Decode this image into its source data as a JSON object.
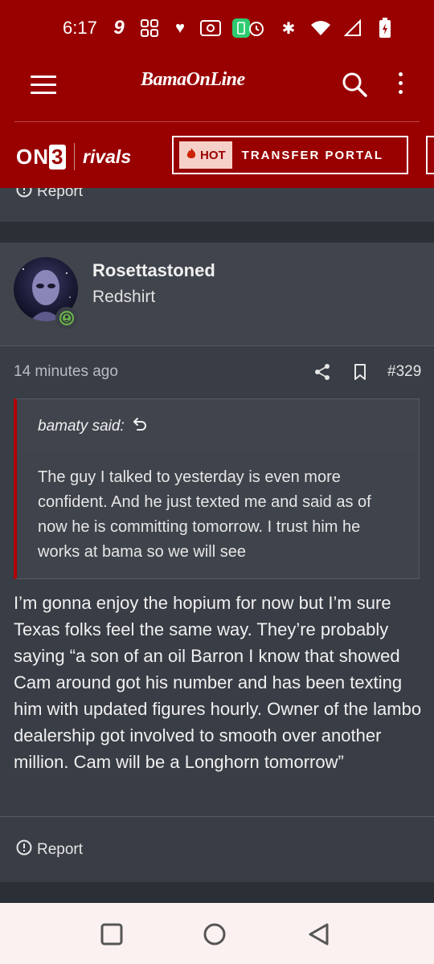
{
  "status_bar": {
    "time": "6:17",
    "left_icons": [
      "nine-app-icon",
      "grid-icon",
      "heart-icon",
      "broadcast-icon",
      "battery-app-icon"
    ],
    "right_icons": [
      "alarm-icon",
      "bluetooth-icon",
      "wifi-icon",
      "signal-icon",
      "battery-icon"
    ]
  },
  "header": {
    "brand": "BamaOnLine",
    "colors": {
      "brand_red": "#990000",
      "surface": "#393d45",
      "accent": "#b30000"
    }
  },
  "subnav": {
    "on3_label_prefix": "ON",
    "on3_label_number": "3",
    "rivals_label": "rivals",
    "hot_badge": "HOT",
    "portal_label": "TRANSFER PORTAL"
  },
  "previous_post": {
    "report_label": "Report"
  },
  "post": {
    "author": "Rosettastoned",
    "author_title": "Redshirt",
    "time_ago": "14 minutes ago",
    "post_number": "#329",
    "quote": {
      "attribution": "bamaty said:",
      "text": "The guy I talked to yesterday is even more confident. And he just texted me and said as of now he is committing tomorrow. I trust him he works at bama so we will see"
    },
    "body": "I’m gonna enjoy the hopium for now but I’m sure Texas folks feel the same way. They’re probably saying “a son of an oil Barron I know that showed Cam around got his number and has been texting him with updated figures hourly. Owner of the lambo dealership got involved to smooth over another million. Cam will be a Longhorn tomorrow”",
    "report_label": "Report"
  },
  "nav_bar": {
    "buttons": [
      "recents-square-icon",
      "home-circle-icon",
      "back-triangle-icon"
    ]
  }
}
